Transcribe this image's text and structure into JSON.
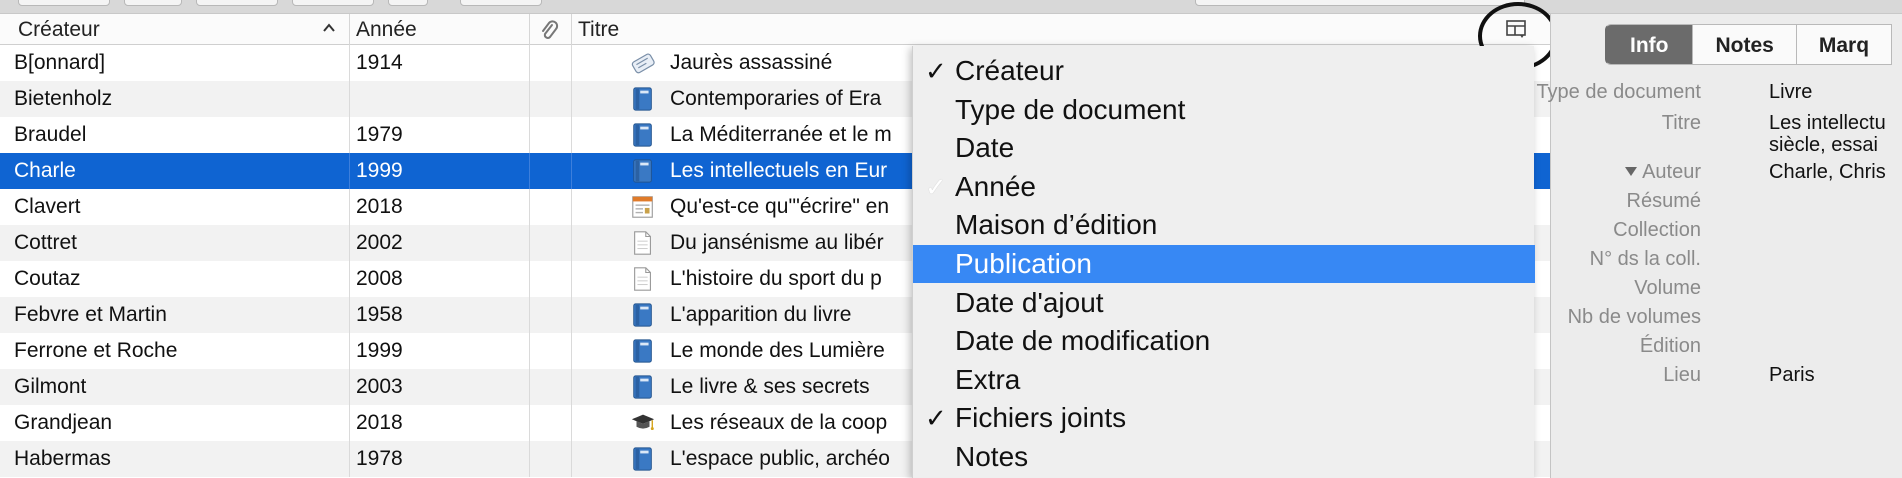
{
  "columns": {
    "creator": "Créateur",
    "year": "Année",
    "title": "Titre"
  },
  "rows": [
    {
      "creator": "B[onnard]",
      "year": "1914",
      "title": "Jaurès assassiné",
      "icon": "newspaper-article-icon",
      "selected": false
    },
    {
      "creator": "Bietenholz",
      "year": "",
      "title": "Contemporaries of Era",
      "icon": "book-icon",
      "selected": false
    },
    {
      "creator": "Braudel",
      "year": "1979",
      "title": "La Méditerranée et le m",
      "icon": "book-icon",
      "selected": false
    },
    {
      "creator": "Charle",
      "year": "1999",
      "title": "Les intellectuels en Eur",
      "icon": "book-icon",
      "selected": true
    },
    {
      "creator": "Clavert",
      "year": "2018",
      "title": "Qu'est-ce qu'\"écrire\" en",
      "icon": "web-page-icon",
      "selected": false
    },
    {
      "creator": "Cottret",
      "year": "2002",
      "title": "Du jansénisme au libér",
      "icon": "document-icon",
      "selected": false
    },
    {
      "creator": "Coutaz",
      "year": "2008",
      "title": "L'histoire du sport du p",
      "icon": "document-icon",
      "selected": false
    },
    {
      "creator": "Febvre et Martin",
      "year": "1958",
      "title": "L'apparition du livre",
      "icon": "book-icon",
      "selected": false
    },
    {
      "creator": "Ferrone et Roche",
      "year": "1999",
      "title": "Le monde des Lumière",
      "icon": "book-icon",
      "selected": false
    },
    {
      "creator": "Gilmont",
      "year": "2003",
      "title": "Le livre & ses secrets",
      "icon": "book-icon",
      "selected": false
    },
    {
      "creator": "Grandjean",
      "year": "2018",
      "title": "Les réseaux de la coop",
      "icon": "thesis-icon",
      "selected": false
    },
    {
      "creator": "Habermas",
      "year": "1978",
      "title": "L'espace public, archéo",
      "icon": "book-icon",
      "selected": false
    }
  ],
  "menu": [
    {
      "label": "Créateur",
      "check": "checked",
      "highlighted": false
    },
    {
      "label": "Type de document",
      "check": "",
      "highlighted": false
    },
    {
      "label": "Date",
      "check": "",
      "highlighted": false
    },
    {
      "label": "Année",
      "check": "dim",
      "highlighted": false
    },
    {
      "label": "Maison d’édition",
      "check": "",
      "highlighted": false
    },
    {
      "label": "Publication",
      "check": "",
      "highlighted": true
    },
    {
      "label": "Date d'ajout",
      "check": "",
      "highlighted": false
    },
    {
      "label": "Date de modification",
      "check": "",
      "highlighted": false
    },
    {
      "label": "Extra",
      "check": "",
      "highlighted": false
    },
    {
      "label": "Fichiers joints",
      "check": "checked",
      "highlighted": false
    },
    {
      "label": "Notes",
      "check": "",
      "highlighted": false
    }
  ],
  "panel": {
    "tabs": [
      "Info",
      "Notes",
      "Marq"
    ],
    "fields": [
      {
        "label": "Type de document",
        "value": "Livre"
      },
      {
        "label": "Titre",
        "value": "Les intellectu",
        "value2": "siècle, essai"
      },
      {
        "label": "Auteur",
        "value": "Charle, Chris",
        "toggle": true
      },
      {
        "label": "Résumé",
        "value": ""
      },
      {
        "label": "Collection",
        "value": ""
      },
      {
        "label": "N° ds la coll.",
        "value": ""
      },
      {
        "label": "Volume",
        "value": ""
      },
      {
        "label": "Nb de volumes",
        "value": ""
      },
      {
        "label": "Édition",
        "value": ""
      },
      {
        "label": "Lieu",
        "value": "Paris"
      }
    ]
  },
  "colors": {
    "selection": "#0f64d2",
    "menu_highlight": "#3788f4",
    "active_tab": "#6b6b6b"
  }
}
